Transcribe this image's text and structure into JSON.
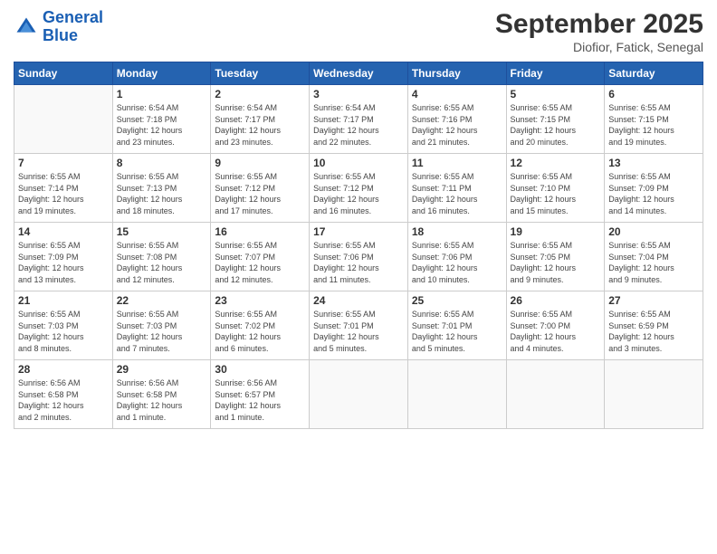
{
  "logo": {
    "line1": "General",
    "line2": "Blue"
  },
  "title": "September 2025",
  "subtitle": "Diofior, Fatick, Senegal",
  "days": [
    "Sunday",
    "Monday",
    "Tuesday",
    "Wednesday",
    "Thursday",
    "Friday",
    "Saturday"
  ],
  "weeks": [
    [
      {
        "num": "",
        "empty": true
      },
      {
        "num": "1",
        "sunrise": "6:54 AM",
        "sunset": "7:18 PM",
        "daylight": "12 hours and 23 minutes."
      },
      {
        "num": "2",
        "sunrise": "6:54 AM",
        "sunset": "7:17 PM",
        "daylight": "12 hours and 23 minutes."
      },
      {
        "num": "3",
        "sunrise": "6:54 AM",
        "sunset": "7:17 PM",
        "daylight": "12 hours and 22 minutes."
      },
      {
        "num": "4",
        "sunrise": "6:55 AM",
        "sunset": "7:16 PM",
        "daylight": "12 hours and 21 minutes."
      },
      {
        "num": "5",
        "sunrise": "6:55 AM",
        "sunset": "7:15 PM",
        "daylight": "12 hours and 20 minutes."
      },
      {
        "num": "6",
        "sunrise": "6:55 AM",
        "sunset": "7:15 PM",
        "daylight": "12 hours and 19 minutes."
      }
    ],
    [
      {
        "num": "7",
        "sunrise": "6:55 AM",
        "sunset": "7:14 PM",
        "daylight": "12 hours and 19 minutes."
      },
      {
        "num": "8",
        "sunrise": "6:55 AM",
        "sunset": "7:13 PM",
        "daylight": "12 hours and 18 minutes."
      },
      {
        "num": "9",
        "sunrise": "6:55 AM",
        "sunset": "7:12 PM",
        "daylight": "12 hours and 17 minutes."
      },
      {
        "num": "10",
        "sunrise": "6:55 AM",
        "sunset": "7:12 PM",
        "daylight": "12 hours and 16 minutes."
      },
      {
        "num": "11",
        "sunrise": "6:55 AM",
        "sunset": "7:11 PM",
        "daylight": "12 hours and 16 minutes."
      },
      {
        "num": "12",
        "sunrise": "6:55 AM",
        "sunset": "7:10 PM",
        "daylight": "12 hours and 15 minutes."
      },
      {
        "num": "13",
        "sunrise": "6:55 AM",
        "sunset": "7:09 PM",
        "daylight": "12 hours and 14 minutes."
      }
    ],
    [
      {
        "num": "14",
        "sunrise": "6:55 AM",
        "sunset": "7:09 PM",
        "daylight": "12 hours and 13 minutes."
      },
      {
        "num": "15",
        "sunrise": "6:55 AM",
        "sunset": "7:08 PM",
        "daylight": "12 hours and 12 minutes."
      },
      {
        "num": "16",
        "sunrise": "6:55 AM",
        "sunset": "7:07 PM",
        "daylight": "12 hours and 12 minutes."
      },
      {
        "num": "17",
        "sunrise": "6:55 AM",
        "sunset": "7:06 PM",
        "daylight": "12 hours and 11 minutes."
      },
      {
        "num": "18",
        "sunrise": "6:55 AM",
        "sunset": "7:06 PM",
        "daylight": "12 hours and 10 minutes."
      },
      {
        "num": "19",
        "sunrise": "6:55 AM",
        "sunset": "7:05 PM",
        "daylight": "12 hours and 9 minutes."
      },
      {
        "num": "20",
        "sunrise": "6:55 AM",
        "sunset": "7:04 PM",
        "daylight": "12 hours and 9 minutes."
      }
    ],
    [
      {
        "num": "21",
        "sunrise": "6:55 AM",
        "sunset": "7:03 PM",
        "daylight": "12 hours and 8 minutes."
      },
      {
        "num": "22",
        "sunrise": "6:55 AM",
        "sunset": "7:03 PM",
        "daylight": "12 hours and 7 minutes."
      },
      {
        "num": "23",
        "sunrise": "6:55 AM",
        "sunset": "7:02 PM",
        "daylight": "12 hours and 6 minutes."
      },
      {
        "num": "24",
        "sunrise": "6:55 AM",
        "sunset": "7:01 PM",
        "daylight": "12 hours and 5 minutes."
      },
      {
        "num": "25",
        "sunrise": "6:55 AM",
        "sunset": "7:01 PM",
        "daylight": "12 hours and 5 minutes."
      },
      {
        "num": "26",
        "sunrise": "6:55 AM",
        "sunset": "7:00 PM",
        "daylight": "12 hours and 4 minutes."
      },
      {
        "num": "27",
        "sunrise": "6:55 AM",
        "sunset": "6:59 PM",
        "daylight": "12 hours and 3 minutes."
      }
    ],
    [
      {
        "num": "28",
        "sunrise": "6:56 AM",
        "sunset": "6:58 PM",
        "daylight": "12 hours and 2 minutes."
      },
      {
        "num": "29",
        "sunrise": "6:56 AM",
        "sunset": "6:58 PM",
        "daylight": "12 hours and 1 minute."
      },
      {
        "num": "30",
        "sunrise": "6:56 AM",
        "sunset": "6:57 PM",
        "daylight": "12 hours and 1 minute."
      },
      {
        "num": "",
        "empty": true
      },
      {
        "num": "",
        "empty": true
      },
      {
        "num": "",
        "empty": true
      },
      {
        "num": "",
        "empty": true
      }
    ]
  ]
}
